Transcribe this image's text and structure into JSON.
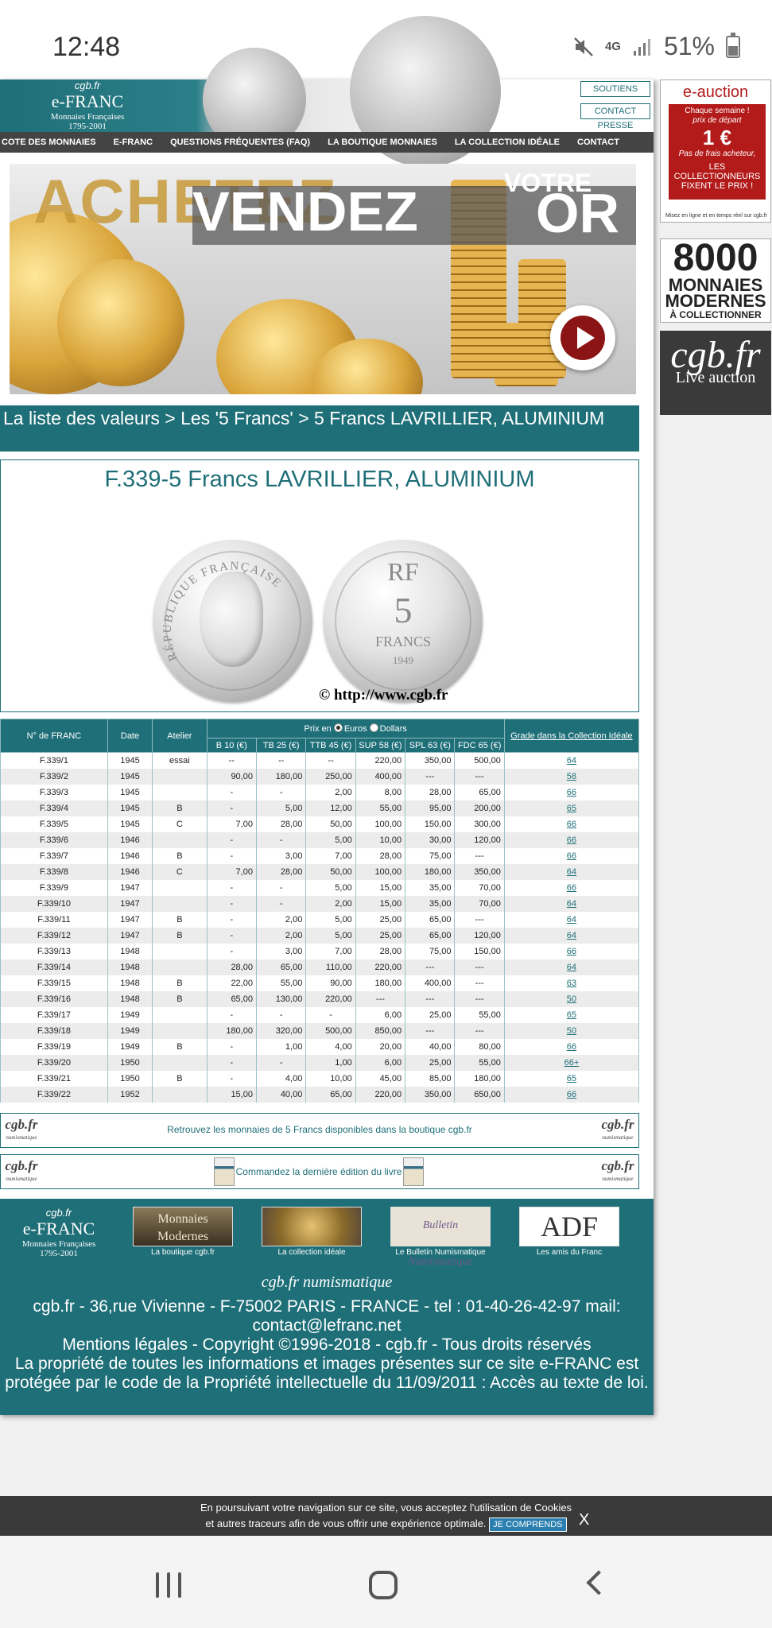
{
  "status": {
    "time": "12:48",
    "network": "4G",
    "battery": "51%"
  },
  "header": {
    "logo_top": "cgb.fr",
    "logo_title": "e-FRANC",
    "logo_sub1": "Monnaies Françaises",
    "logo_sub2": "1795-2001",
    "btn_soutiens": "SOUTIENS",
    "btn_contact_presse": "CONTACT PRESSE"
  },
  "nav": {
    "items": [
      "COTE DES MONNAIES",
      "E-FRANC",
      "QUESTIONS FRÉQUENTES (FAQ)",
      "LA BOUTIQUE MONNAIES",
      "LA COLLECTION IDÉALE",
      "CONTACT"
    ]
  },
  "banner": {
    "achetez": "ACHETEZ",
    "vendez": "VENDEZ",
    "votre": "VOTRE",
    "or": "OR"
  },
  "breadcrumb": "La liste des valeurs > Les '5 Francs' > 5 Francs LAVRILLIER, ALUMINIUM",
  "coin": {
    "title": "F.339-5 Francs LAVRILLIER, ALUMINIUM",
    "obverse_legend": "RÉPUBLIQUE FRANÇAISE",
    "reverse_rf": "RF",
    "reverse_value": "5",
    "reverse_francs": "FRANCS",
    "reverse_year": "1949",
    "copyright": "© http://www.cgb.fr"
  },
  "table": {
    "headers": {
      "num": "N° de FRANC",
      "date": "Date",
      "atelier": "Atelier",
      "prix_en": "Prix en",
      "euros": "Euros",
      "dollars": "Dollars",
      "grade": "Grade dans la Collection Idéale"
    },
    "grades": [
      "B 10 (€)",
      "TB 25 (€)",
      "TTB 45 (€)",
      "SUP 58 (€)",
      "SPL 63 (€)",
      "FDC 65 (€)"
    ],
    "rows": [
      [
        "F.339/1",
        "1945",
        "essai",
        "--",
        "--",
        "--",
        "220,00",
        "350,00",
        "500,00",
        "64"
      ],
      [
        "F.339/2",
        "1945",
        "",
        "90,00",
        "180,00",
        "250,00",
        "400,00",
        "---",
        "---",
        "58"
      ],
      [
        "F.339/3",
        "1945",
        "",
        "-",
        "-",
        "2,00",
        "8,00",
        "28,00",
        "65,00",
        "66"
      ],
      [
        "F.339/4",
        "1945",
        "B",
        "-",
        "5,00",
        "12,00",
        "55,00",
        "95,00",
        "200,00",
        "65"
      ],
      [
        "F.339/5",
        "1945",
        "C",
        "7,00",
        "28,00",
        "50,00",
        "100,00",
        "150,00",
        "300,00",
        "66"
      ],
      [
        "F.339/6",
        "1946",
        "",
        "-",
        "-",
        "5,00",
        "10,00",
        "30,00",
        "120,00",
        "66"
      ],
      [
        "F.339/7",
        "1946",
        "B",
        "-",
        "3,00",
        "7,00",
        "28,00",
        "75,00",
        "---",
        "66"
      ],
      [
        "F.339/8",
        "1946",
        "C",
        "7,00",
        "28,00",
        "50,00",
        "100,00",
        "180,00",
        "350,00",
        "64"
      ],
      [
        "F.339/9",
        "1947",
        "",
        "-",
        "-",
        "5,00",
        "15,00",
        "35,00",
        "70,00",
        "66"
      ],
      [
        "F.339/10",
        "1947",
        "",
        "-",
        "-",
        "2,00",
        "15,00",
        "35,00",
        "70,00",
        "64"
      ],
      [
        "F.339/11",
        "1947",
        "B",
        "-",
        "2,00",
        "5,00",
        "25,00",
        "65,00",
        "---",
        "64"
      ],
      [
        "F.339/12",
        "1947",
        "B",
        "-",
        "2,00",
        "5,00",
        "25,00",
        "65,00",
        "120,00",
        "64"
      ],
      [
        "F.339/13",
        "1948",
        "",
        "-",
        "3,00",
        "7,00",
        "28,00",
        "75,00",
        "150,00",
        "66"
      ],
      [
        "F.339/14",
        "1948",
        "",
        "28,00",
        "65,00",
        "110,00",
        "220,00",
        "---",
        "---",
        "64"
      ],
      [
        "F.339/15",
        "1948",
        "B",
        "22,00",
        "55,00",
        "90,00",
        "180,00",
        "400,00",
        "---",
        "63"
      ],
      [
        "F.339/16",
        "1948",
        "B",
        "65,00",
        "130,00",
        "220,00",
        "---",
        "---",
        "---",
        "50"
      ],
      [
        "F.339/17",
        "1949",
        "",
        "-",
        "-",
        "-",
        "6,00",
        "25,00",
        "55,00",
        "65"
      ],
      [
        "F.339/18",
        "1949",
        "",
        "180,00",
        "320,00",
        "500,00",
        "850,00",
        "---",
        "---",
        "50"
      ],
      [
        "F.339/19",
        "1949",
        "B",
        "-",
        "1,00",
        "4,00",
        "20,00",
        "40,00",
        "80,00",
        "66"
      ],
      [
        "F.339/20",
        "1950",
        "",
        "-",
        "-",
        "1,00",
        "6,00",
        "25,00",
        "55,00",
        "66+"
      ],
      [
        "F.339/21",
        "1950",
        "B",
        "-",
        "4,00",
        "10,00",
        "45,00",
        "85,00",
        "180,00",
        "65"
      ],
      [
        "F.339/22",
        "1952",
        "",
        "15,00",
        "40,00",
        "65,00",
        "220,00",
        "350,00",
        "650,00",
        "66"
      ]
    ]
  },
  "info": {
    "mini_logo": "cgb.fr",
    "mini_logo_sub": "numismatique",
    "boutique_text": "Retrouvez les monnaies de 5 Francs disponibles dans la boutique cgb.fr",
    "livre_text": "Commandez la dernière édition du livre"
  },
  "footer": {
    "logo_top": "cgb.fr",
    "logo_title": "e-FRANC",
    "logo_sub1": "Monnaies Françaises",
    "logo_sub2": "1795-2001",
    "items": [
      {
        "img": "Monnaies Modernes",
        "label": "La boutique cgb.fr"
      },
      {
        "img": "",
        "label": "La collection idéale"
      },
      {
        "img": "Bulletin Numismatique",
        "label": "Le Bulletin Numismatique"
      },
      {
        "img": "ADF",
        "label": "Les amis du Franc"
      }
    ],
    "cgb_logo": "cgb.fr numismatique",
    "address": "cgb.fr - 36,rue Vivienne - F-75002 PARIS - FRANCE - tel : 01-40-26-42-97 mail: contact@lefranc.net",
    "copyright": "Mentions légales - Copyright ©1996-2018 - cgb.fr - Tous droits réservés",
    "legal": "La propriété de toutes les informations et images présentes sur ce site e-FRANC est protégée par le code de la Propriété intellectuelle du 11/09/2011 : Accès au texte de loi."
  },
  "sidebar": {
    "eauction_title": "e-auction",
    "eauction_l1": "Chaque semaine !",
    "eauction_l2": "prix de départ",
    "eauction_price": "1 €",
    "eauction_l3": "Pas de frais acheteur,",
    "eauction_l4": "LES COLLECTIONNEURS FIXENT LE PRIX !",
    "eauction_foot": "Misez en ligne et en temps réel sur cgb.fr",
    "modernes_n": "8000",
    "modernes_m1": "MONNAIES",
    "modernes_m2": "MODERNES",
    "modernes_s": "À COLLECTIONNER",
    "live_title": "cgb.fr",
    "live_sub": "Live auction"
  },
  "cookie": {
    "line1": "En poursuivant votre navigation sur ce site, vous acceptez l'utilisation de Cookies",
    "line2": "et autres traceurs afin de vous offrir une expérience optimale.",
    "button": "JE COMPRENDS",
    "close": "X"
  },
  "colors": {
    "teal": "#1f6f78",
    "nav_dark": "#444444",
    "auction_red": "#b31b1b"
  }
}
